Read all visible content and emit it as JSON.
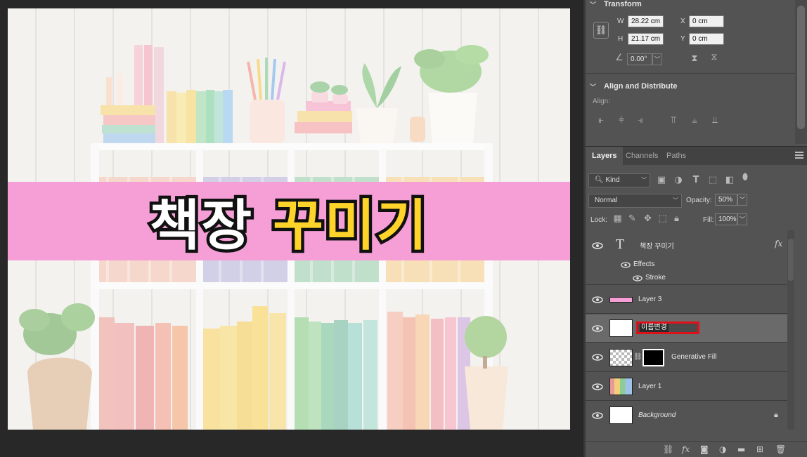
{
  "canvas": {
    "title_word1": "책장",
    "title_word2": "꾸미기",
    "colors": {
      "banner": "#f59fd6",
      "title_accent": "#ffd42a",
      "title_stroke": "#111111"
    }
  },
  "transform": {
    "header": "Transform",
    "w_label": "W",
    "w_value": "28.22 cm",
    "h_label": "H",
    "h_value": "21.17 cm",
    "x_label": "X",
    "x_value": "0 cm",
    "y_label": "Y",
    "y_value": "0 cm",
    "angle_value": "0.00°"
  },
  "align": {
    "header": "Align and Distribute",
    "label": "Align:"
  },
  "tabs": [
    {
      "label": "Layers",
      "active": true
    },
    {
      "label": "Channels",
      "active": false
    },
    {
      "label": "Paths",
      "active": false
    }
  ],
  "filter": {
    "kind_label": "Kind"
  },
  "blend": {
    "mode": "Normal",
    "opacity_label": "Opacity:",
    "opacity_value": "50%",
    "lock_label": "Lock:",
    "fill_label": "Fill:",
    "fill_value": "100%"
  },
  "layers": {
    "text_layer": "책장 꾸미기",
    "effects_label": "Effects",
    "stroke_label": "Stroke",
    "fx": "fx",
    "layer3": "Layer 3",
    "rename_value": "이름변경",
    "generative": "Generative Fill",
    "layer1": "Layer 1",
    "background": "Background"
  }
}
